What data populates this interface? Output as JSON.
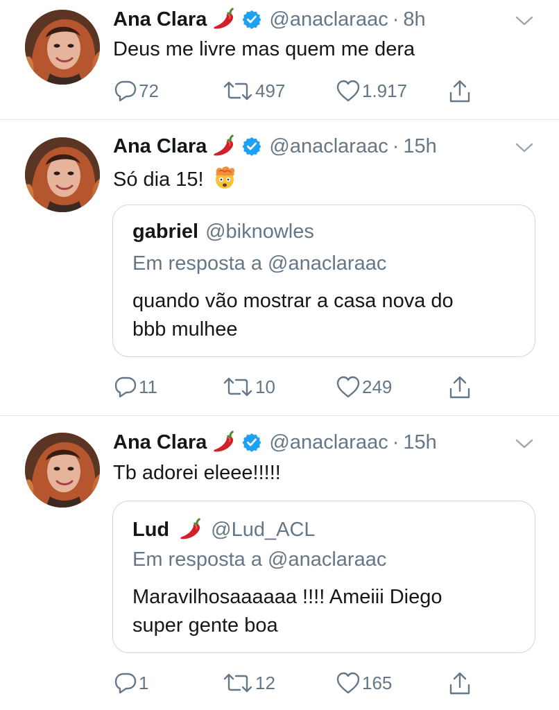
{
  "colors": {
    "text": "#14171a",
    "muted": "#657786",
    "verified": "#1da1f2",
    "border": "#ccd6dd"
  },
  "tweets": [
    {
      "name": "Ana Clara",
      "handle": "@anaclaraac",
      "sep": "·",
      "time": "8h",
      "text": "Deus me livre mas quem me dera",
      "replies": "72",
      "retweets": "497",
      "likes": "1.917"
    },
    {
      "name": "Ana Clara",
      "handle": "@anaclaraac",
      "sep": "·",
      "time": "15h",
      "text": "Só dia 15!",
      "emoji": "exploding-head-emoji",
      "quote": {
        "name": "gabriel",
        "handle": "@biknowles",
        "reply_to": "Em resposta a @anaclaraac",
        "line1": "quando vão mostrar a casa nova do",
        "line2": "bbb mulhee"
      },
      "replies": "11",
      "retweets": "10",
      "likes": "249"
    },
    {
      "name": "Ana Clara",
      "handle": "@anaclaraac",
      "sep": "·",
      "time": "15h",
      "text": "Tb adorei eleee!!!!!",
      "quote": {
        "name": "Lud",
        "handle": "@Lud_ACL",
        "reply_to": "Em resposta a @anaclaraac",
        "line1": "Maravilhosaaaaaa !!!! Ameiii Diego",
        "line2": "super gente boa"
      },
      "replies": "1",
      "retweets": "12",
      "likes": "165"
    }
  ]
}
